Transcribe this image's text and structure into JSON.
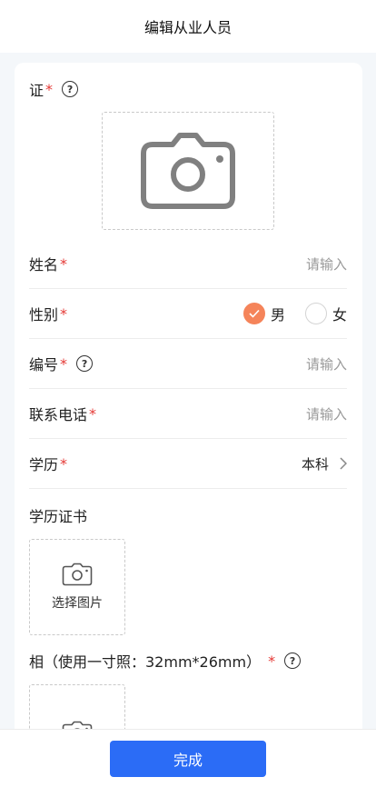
{
  "header": {
    "title": "编辑从业人员"
  },
  "certificate": {
    "label": "证",
    "required_mark": "*"
  },
  "fields": {
    "name": {
      "label": "姓名",
      "required_mark": "*",
      "placeholder": "请输入"
    },
    "gender": {
      "label": "性别",
      "required_mark": "*",
      "options": [
        {
          "label": "男",
          "selected": true
        },
        {
          "label": "女",
          "selected": false
        }
      ]
    },
    "number": {
      "label": "编号",
      "required_mark": "*",
      "placeholder": "请输入"
    },
    "phone": {
      "label": "联系电话",
      "required_mark": "*",
      "placeholder": "请输入"
    },
    "education": {
      "label": "学历",
      "required_mark": "*",
      "value": "本科"
    }
  },
  "edu_certificate": {
    "label": "学历证书",
    "upload_text": "选择图片"
  },
  "photo": {
    "label": "相（使用一寸照：32mm*26mm）",
    "required_mark": "*"
  },
  "footer": {
    "done_label": "完成"
  },
  "colors": {
    "accent": "#2b6cf6",
    "radio_selected": "#f5845a",
    "required": "#e53935"
  }
}
